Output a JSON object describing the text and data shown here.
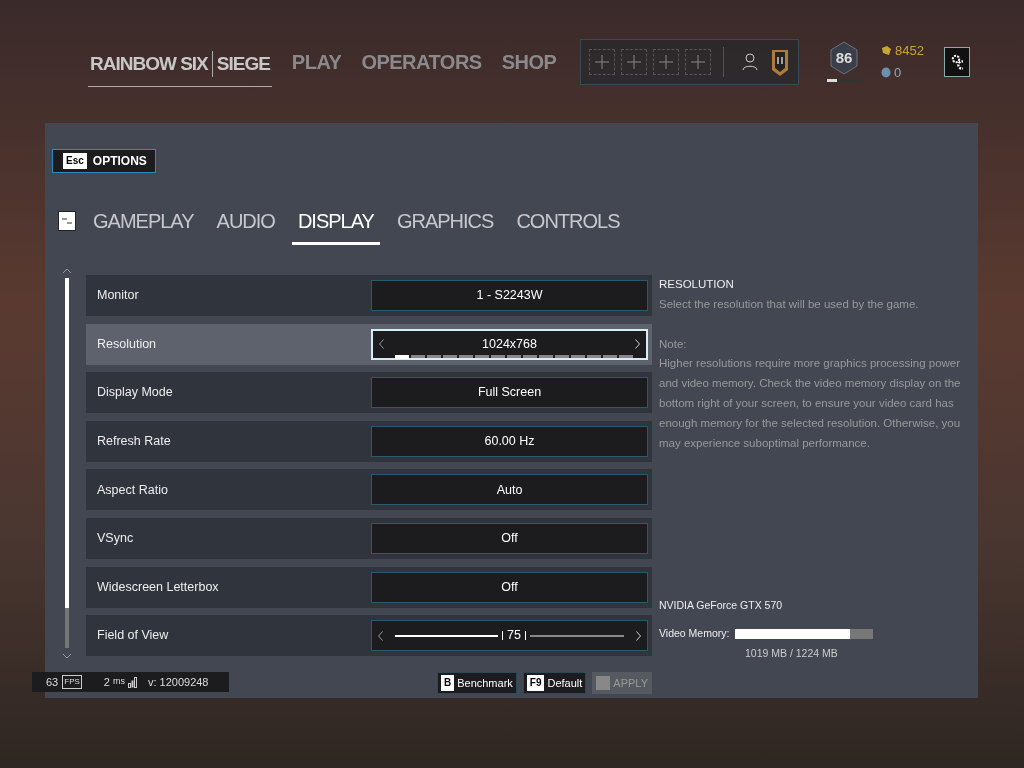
{
  "header": {
    "logo_left": "RAINBOW SIX",
    "logo_right": "SIEGE",
    "nav": [
      {
        "label": "PLAY"
      },
      {
        "label": "OPERATORS"
      },
      {
        "label": "SHOP"
      }
    ],
    "level_badge": "86",
    "level": 0.3,
    "renown": "8452",
    "credits": "0"
  },
  "back_button": {
    "key": "Esc",
    "label": "OPTIONS"
  },
  "tabs": [
    {
      "label": "GAMEPLAY",
      "selected": false
    },
    {
      "label": "AUDIO",
      "selected": false
    },
    {
      "label": "DISPLAY",
      "selected": true
    },
    {
      "label": "GRAPHICS",
      "selected": false
    },
    {
      "label": "CONTROLS",
      "selected": false
    }
  ],
  "settings": [
    {
      "kind": "select",
      "label": "Monitor",
      "value": "1 - S2243W",
      "selected": false
    },
    {
      "kind": "carousel",
      "label": "Resolution",
      "value": "1024x768",
      "selected": true,
      "segments": [
        {
          "selected": true
        },
        {
          "selected": false
        },
        {
          "selected": false
        },
        {
          "selected": false
        },
        {
          "selected": false
        },
        {
          "selected": false
        },
        {
          "selected": false
        },
        {
          "selected": false
        },
        {
          "selected": false
        },
        {
          "selected": false
        },
        {
          "selected": false
        },
        {
          "selected": false
        },
        {
          "selected": false
        },
        {
          "selected": false
        },
        {
          "selected": false
        }
      ]
    },
    {
      "kind": "select",
      "label": "Display Mode",
      "value": "Full Screen",
      "selected": false
    },
    {
      "kind": "select",
      "label": "Refresh Rate",
      "value": "60.00 Hz",
      "selected": false
    },
    {
      "kind": "select",
      "label": "Aspect Ratio",
      "value": "Auto",
      "selected": false
    },
    {
      "kind": "select",
      "label": "VSync",
      "value": "Off",
      "selected": false
    },
    {
      "kind": "select",
      "label": "Widescreen Letterbox",
      "value": "Off",
      "selected": false
    },
    {
      "kind": "slider",
      "label": "Field of View",
      "value": "75",
      "level": 0.45,
      "selected": false
    }
  ],
  "description": {
    "title": "RESOLUTION",
    "text": "Select the resolution that will be used by the game.",
    "note_label": "Note:",
    "note": "Higher resolutions require more graphics processing power and video memory. Check the video memory display on the bottom right of your screen, to ensure your video card has enough memory for the selected resolution. Otherwise, you may experience suboptimal performance."
  },
  "gpu": {
    "name": "NVIDIA GeForce GTX 570",
    "memory_label": "Video Memory:",
    "level": 0.83,
    "reading": "1019 MB / 1224 MB"
  },
  "buttons": [
    {
      "key": "B",
      "label": "Benchmark",
      "disabled": false
    },
    {
      "key": "F9",
      "label": "Default",
      "disabled": false
    },
    {
      "label": "APPLY",
      "disabled": true
    }
  ],
  "status_bar": {
    "fps": "63",
    "fps_label": "FPS",
    "ping": "2",
    "ping_unit": "ms",
    "version": "v: 12009248"
  }
}
